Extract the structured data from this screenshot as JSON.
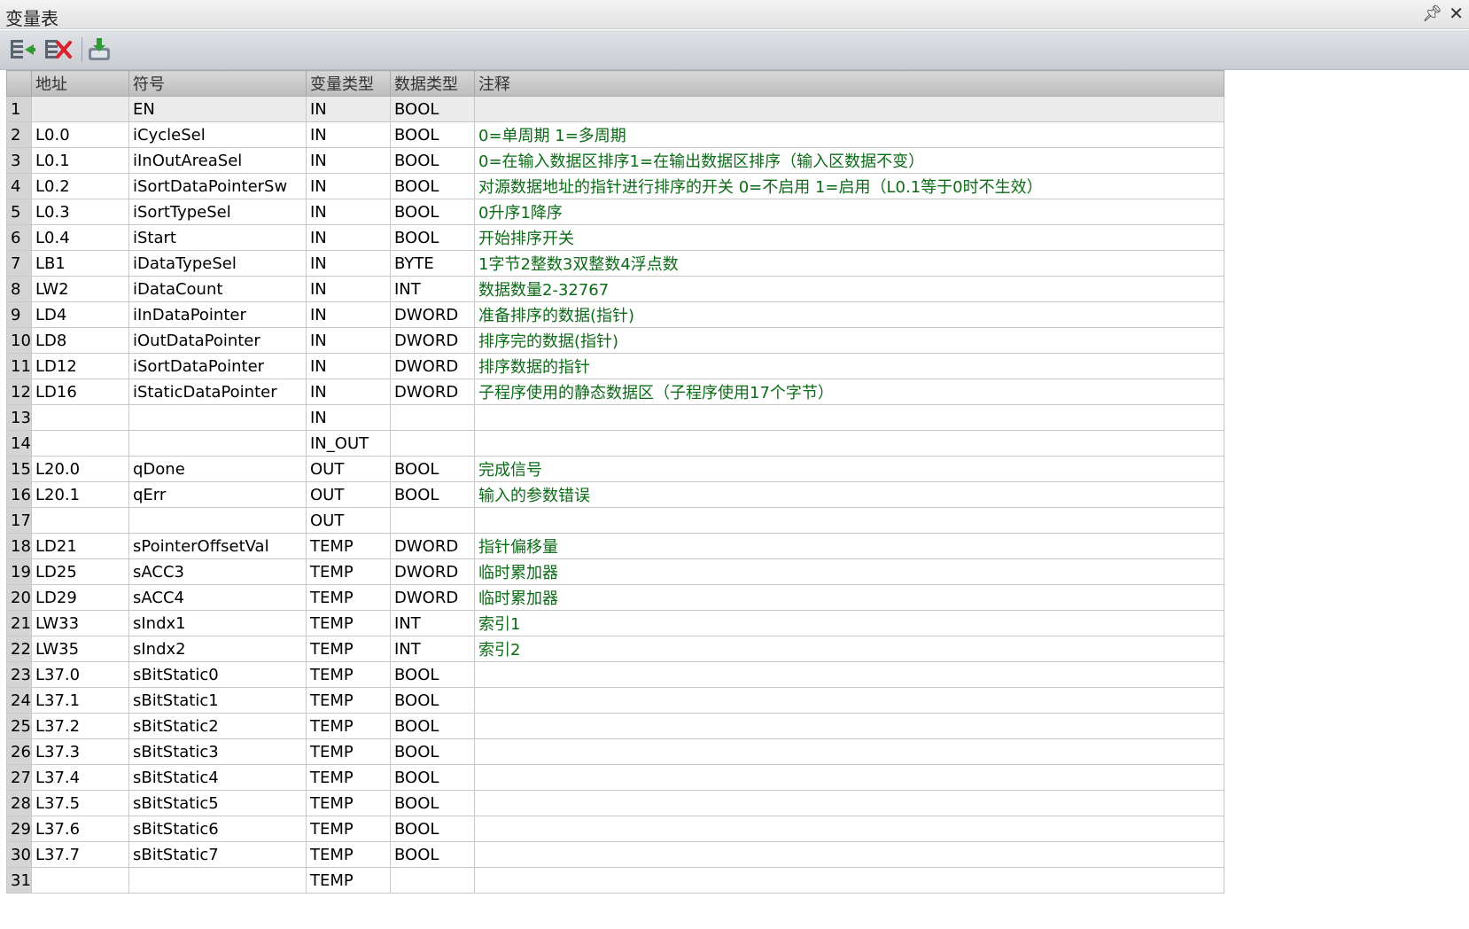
{
  "window": {
    "title": "变量表"
  },
  "toolbar": {
    "buttons": [
      "insert-row-icon",
      "delete-row-icon",
      "download-icon"
    ]
  },
  "columns": [
    "",
    "地址",
    "符号",
    "变量类型",
    "数据类型",
    "注释"
  ],
  "rows": [
    {
      "num": "1",
      "addr": "",
      "sym": "EN",
      "vtype": "IN",
      "dtype": "BOOL",
      "comment": ""
    },
    {
      "num": "2",
      "addr": "L0.0",
      "sym": "iCycleSel",
      "vtype": "IN",
      "dtype": "BOOL",
      "comment": "0=单周期 1=多周期"
    },
    {
      "num": "3",
      "addr": "L0.1",
      "sym": "iInOutAreaSel",
      "vtype": "IN",
      "dtype": "BOOL",
      "comment": "0=在输入数据区排序1=在输出数据区排序（输入区数据不变）"
    },
    {
      "num": "4",
      "addr": "L0.2",
      "sym": "iSortDataPointerSw",
      "vtype": "IN",
      "dtype": "BOOL",
      "comment": "对源数据地址的指针进行排序的开关 0=不启用 1=启用（L0.1等于0时不生效）"
    },
    {
      "num": "5",
      "addr": "L0.3",
      "sym": "iSortTypeSel",
      "vtype": "IN",
      "dtype": "BOOL",
      "comment": "0升序1降序"
    },
    {
      "num": "6",
      "addr": "L0.4",
      "sym": "iStart",
      "vtype": "IN",
      "dtype": "BOOL",
      "comment": "开始排序开关"
    },
    {
      "num": "7",
      "addr": "LB1",
      "sym": "iDataTypeSel",
      "vtype": "IN",
      "dtype": "BYTE",
      "comment": "1字节2整数3双整数4浮点数"
    },
    {
      "num": "8",
      "addr": "LW2",
      "sym": "iDataCount",
      "vtype": "IN",
      "dtype": "INT",
      "comment": "数据数量2-32767"
    },
    {
      "num": "9",
      "addr": "LD4",
      "sym": "iInDataPointer",
      "vtype": "IN",
      "dtype": "DWORD",
      "comment": "准备排序的数据(指针)"
    },
    {
      "num": "10",
      "addr": "LD8",
      "sym": "iOutDataPointer",
      "vtype": "IN",
      "dtype": "DWORD",
      "comment": "排序完的数据(指针)"
    },
    {
      "num": "11",
      "addr": "LD12",
      "sym": "iSortDataPointer",
      "vtype": "IN",
      "dtype": "DWORD",
      "comment": "排序数据的指针"
    },
    {
      "num": "12",
      "addr": "LD16",
      "sym": "iStaticDataPointer",
      "vtype": "IN",
      "dtype": "DWORD",
      "comment": "子程序使用的静态数据区（子程序使用17个字节）"
    },
    {
      "num": "13",
      "addr": "",
      "sym": "",
      "vtype": "IN",
      "dtype": "",
      "comment": ""
    },
    {
      "num": "14",
      "addr": "",
      "sym": "",
      "vtype": "IN_OUT",
      "dtype": "",
      "comment": ""
    },
    {
      "num": "15",
      "addr": "L20.0",
      "sym": "qDone",
      "vtype": "OUT",
      "dtype": "BOOL",
      "comment": "完成信号"
    },
    {
      "num": "16",
      "addr": "L20.1",
      "sym": "qErr",
      "vtype": "OUT",
      "dtype": "BOOL",
      "comment": "输入的参数错误"
    },
    {
      "num": "17",
      "addr": "",
      "sym": "",
      "vtype": "OUT",
      "dtype": "",
      "comment": ""
    },
    {
      "num": "18",
      "addr": "LD21",
      "sym": "sPointerOffsetVal",
      "vtype": "TEMP",
      "dtype": "DWORD",
      "comment": "指针偏移量"
    },
    {
      "num": "19",
      "addr": "LD25",
      "sym": "sACC3",
      "vtype": "TEMP",
      "dtype": "DWORD",
      "comment": "临时累加器"
    },
    {
      "num": "20",
      "addr": "LD29",
      "sym": "sACC4",
      "vtype": "TEMP",
      "dtype": "DWORD",
      "comment": "临时累加器"
    },
    {
      "num": "21",
      "addr": "LW33",
      "sym": "sIndx1",
      "vtype": "TEMP",
      "dtype": "INT",
      "comment": "索引1"
    },
    {
      "num": "22",
      "addr": "LW35",
      "sym": "sIndx2",
      "vtype": "TEMP",
      "dtype": "INT",
      "comment": "索引2"
    },
    {
      "num": "23",
      "addr": "L37.0",
      "sym": "sBitStatic0",
      "vtype": "TEMP",
      "dtype": "BOOL",
      "comment": ""
    },
    {
      "num": "24",
      "addr": "L37.1",
      "sym": "sBitStatic1",
      "vtype": "TEMP",
      "dtype": "BOOL",
      "comment": ""
    },
    {
      "num": "25",
      "addr": "L37.2",
      "sym": "sBitStatic2",
      "vtype": "TEMP",
      "dtype": "BOOL",
      "comment": ""
    },
    {
      "num": "26",
      "addr": "L37.3",
      "sym": "sBitStatic3",
      "vtype": "TEMP",
      "dtype": "BOOL",
      "comment": ""
    },
    {
      "num": "27",
      "addr": "L37.4",
      "sym": "sBitStatic4",
      "vtype": "TEMP",
      "dtype": "BOOL",
      "comment": ""
    },
    {
      "num": "28",
      "addr": "L37.5",
      "sym": "sBitStatic5",
      "vtype": "TEMP",
      "dtype": "BOOL",
      "comment": ""
    },
    {
      "num": "29",
      "addr": "L37.6",
      "sym": "sBitStatic6",
      "vtype": "TEMP",
      "dtype": "BOOL",
      "comment": ""
    },
    {
      "num": "30",
      "addr": "L37.7",
      "sym": "sBitStatic7",
      "vtype": "TEMP",
      "dtype": "BOOL",
      "comment": ""
    },
    {
      "num": "31",
      "addr": "",
      "sym": "",
      "vtype": "TEMP",
      "dtype": "",
      "comment": ""
    }
  ],
  "selected_row": "13",
  "colors": {
    "comment_text": "#0c6b16",
    "header_bg": "#c8c8c8",
    "rownum_bg": "#d4d4d4"
  }
}
